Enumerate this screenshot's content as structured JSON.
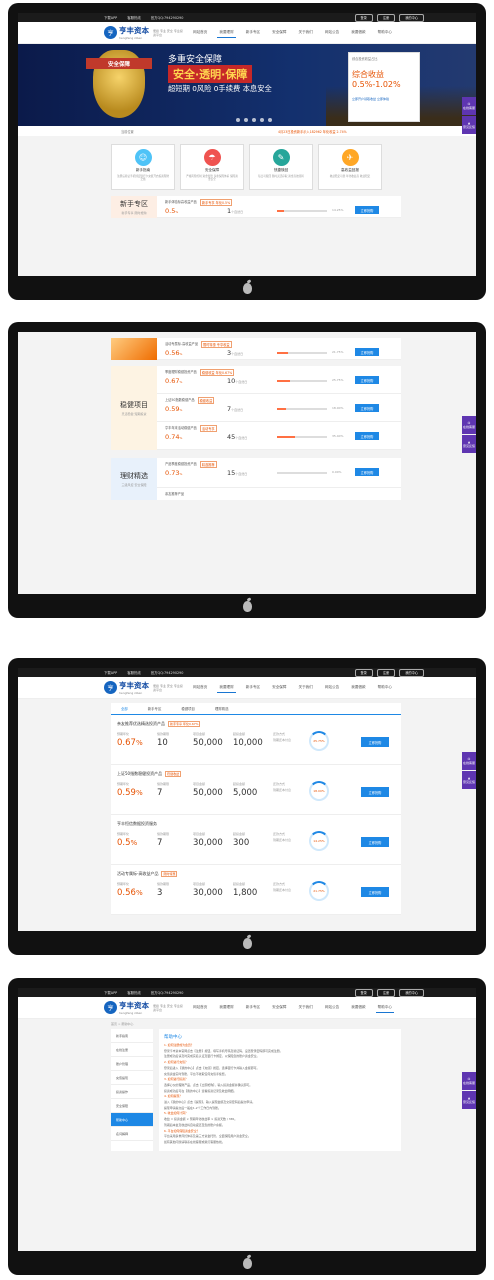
{
  "topbar": {
    "download": "下载APP",
    "phone": "客服热线",
    "qq": "官方QQ:794290290",
    "btn_login": "登录",
    "btn_register": "注册",
    "btn_center": "我的中心"
  },
  "logo": {
    "mark": "亨",
    "name": "亨丰资本",
    "pinyin": "hengfeng ziben",
    "slogan": "便捷 专业 安全 专业投资平台"
  },
  "menu": [
    "网站首页",
    "我要理财",
    "新手专区",
    "安全保障",
    "关于我们",
    "网站公告",
    "我要借款",
    "帮助中心",
    "新手帮助"
  ],
  "banner": {
    "badge": "安全保障",
    "h1": "多重安全保障",
    "h2": "安全·透明·保障",
    "h3": "超短期 0风险 0手续费 本息安全",
    "card_title": "综合投资收益占比",
    "card_head": "综合收益",
    "card_value": "0.5%-1.02%",
    "card_link": "立即开户领取收益 立即体验"
  },
  "notice": {
    "crumb": "当前位置",
    "text": "4月23日投资新手示入182962 年化收益 2.74%"
  },
  "features": [
    {
      "icon": "☺",
      "title": "新手指南",
      "desc": "注册后验证手机绑定银行卡充值开启投资理财之旅",
      "color": "#4fc3f7"
    },
    {
      "icon": "☂",
      "title": "安全保障",
      "desc": "严格风险控制 资金监管 多重保障体系 保障资金安全",
      "color": "#ef5350"
    },
    {
      "icon": "✎",
      "title": "快捷赎回",
      "desc": "每日可赎回 随时灵活存取 资金高效流转",
      "color": "#26a69a"
    },
    {
      "icon": "✈",
      "title": "高收益回报",
      "desc": "收益稳定可靠 年化收益高 收益稳定",
      "color": "#ffa726"
    }
  ],
  "section_newbie": {
    "title": "新手专区",
    "sub": "新手专享 限时抢购",
    "rows": [
      {
        "name": "新手体验标高收益产品",
        "tag": "新手专享 年化0.5%",
        "rate": "0.5",
        "days": "1",
        "pct": "14.25%",
        "fill": 0.14,
        "buy": "立即抢购"
      }
    ]
  },
  "screen2": {
    "r1": {
      "name": "活动专属标-高收益产品",
      "tag": "限时特惠 专享收益",
      "rate": "0.56",
      "days": "3",
      "pct": "21.75%",
      "fill": 0.22,
      "buy": "立即抢购"
    },
    "stable": {
      "title": "稳健项目",
      "sub": "灵活稳健 短期投资",
      "rows": [
        {
          "name": "季度理财稳健投资产品",
          "tag": "稳健收益 年化0.67%",
          "rate": "0.67",
          "days": "10",
          "pct": "25.75%",
          "fill": 0.26,
          "buy": "立即抢购"
        },
        {
          "name": "上证50指数稳健产品",
          "tag": "稳健收益",
          "rate": "0.59",
          "days": "7",
          "pct": "18.00%",
          "fill": 0.18,
          "buy": "立即抢购"
        },
        {
          "name": "亨丰年末活动稳健产品",
          "tag": "活动专享",
          "rate": "0.74",
          "days": "45",
          "pct": "35.40%",
          "fill": 0.35,
          "buy": "立即抢购"
        }
      ]
    },
    "finance": {
      "title": "理财精选",
      "sub": "三级风控 安全保障",
      "rows": [
        {
          "name": "产品季度稳健投资产品",
          "tag": "精选推荐",
          "rate": "0.73",
          "days": "15",
          "pct": "0.00%",
          "fill": 0.0,
          "buy": "立即抢购"
        }
      ]
    },
    "footer_tag": "亲友推荐产品"
  },
  "screen3": {
    "tabs": [
      "全部",
      "新手专区",
      "稳健项目",
      "理财精选"
    ],
    "cards": [
      {
        "title": "亲友推荐优选精选投资产品",
        "tag": "新手专享 年化0.67%",
        "rate": "0.67",
        "rate_unit": "%",
        "days": "10",
        "amount": "50,000",
        "min": "10,000",
        "ring": "25.75%",
        "buy": "立即抢购"
      },
      {
        "title": "上证50指数稳健投资产品",
        "tag": "稳健收益",
        "rate": "0.59",
        "rate_unit": "%",
        "days": "7",
        "amount": "50,000",
        "min": "5,000",
        "ring": "18.00%",
        "buy": "立即抢购"
      },
      {
        "title": "亨丰恒信数据投资服务",
        "tag": "",
        "rate": "0.5",
        "rate_unit": "%",
        "days": "7",
        "amount": "30,000",
        "min": "300",
        "ring": "14.25%",
        "buy": "立即抢购"
      },
      {
        "title": "活动专属标-高收益产品",
        "tag": "限时特惠",
        "rate": "0.56",
        "rate_unit": "%",
        "days": "3",
        "amount": "30,000",
        "min": "1,800",
        "ring": "21.75%",
        "buy": "立即抢购"
      }
    ],
    "col_labels": {
      "rate": "预期年化",
      "days": "借款期限",
      "amount": "项目金额",
      "min": "起投金额",
      "repay": "还款方式",
      "repay_v": "到期还本付息"
    }
  },
  "screen4": {
    "crumb": "首页 > 帮助中心",
    "side": [
      "新手指南",
      "在线注册",
      "账户管理",
      "充值提现",
      "投资操作",
      "安全保障",
      "帮助中心",
      "名词解释"
    ],
    "side_active": 6,
    "title": "帮助中心",
    "lines": [
      {
        "q": true,
        "t": "1. 如何注册成为会员？"
      },
      {
        "q": false,
        "t": "登录亨丰资本官网点击【注册】按钮，填写手机号码及验证码，设置登录密码即可完成注册。"
      },
      {
        "q": false,
        "t": "注册成功后请及时完成实名认证及银行卡绑定，以保障您的账户资金安全。"
      },
      {
        "q": true,
        "t": "2. 如何进行充值？"
      },
      {
        "q": false,
        "t": "登录后进入【我的中心】点击【充值】按钮，选择银行卡并输入金额即可。"
      },
      {
        "q": false,
        "t": "充值资金实时到账，平台不收取任何充值手续费。"
      },
      {
        "q": true,
        "t": "3. 如何进行投资？"
      },
      {
        "q": false,
        "t": "选择心仪的理财产品，点击【立即抢购】，输入投资金额并确认即可。"
      },
      {
        "q": false,
        "t": "投资成功后可在【我的中心】查看投资记录及收益明细。"
      },
      {
        "q": true,
        "t": "4. 如何提现？"
      },
      {
        "q": false,
        "t": "进入【我的中心】点击【提现】，输入提现金额及交易密码后提交申请。"
      },
      {
        "q": false,
        "t": "提现申请提交后一般在1-2个工作日内到账。"
      },
      {
        "q": true,
        "t": "5. 收益如何计算？"
      },
      {
        "q": false,
        "t": "收益 = 投资金额 × 预期年化收益率 × 投资天数 / 365。"
      },
      {
        "q": false,
        "t": "到期后本金及收益将自动返还至您的账户余额。"
      },
      {
        "q": true,
        "t": "6. 平台如何保障资金安全？"
      },
      {
        "q": false,
        "t": "平台采用多重风控体系及第三方资金托管，全面保障用户资金安全。"
      },
      {
        "q": false,
        "t": "如有其他问题请联系在线客服或拨打客服热线。"
      }
    ]
  },
  "tools": {
    "service": "在线客服",
    "feedback": "意见反馈"
  }
}
